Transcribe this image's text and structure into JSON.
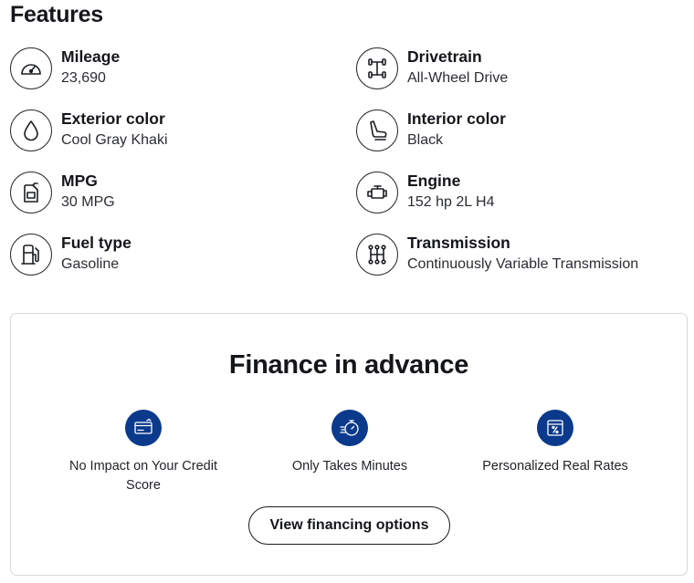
{
  "features": {
    "title": "Features",
    "items": [
      {
        "icon": "speedometer-icon",
        "label": "Mileage",
        "value": "23,690"
      },
      {
        "icon": "drivetrain-icon",
        "label": "Drivetrain",
        "value": "All-Wheel Drive"
      },
      {
        "icon": "drop-icon",
        "label": "Exterior color",
        "value": "Cool Gray Khaki"
      },
      {
        "icon": "car-seat-icon",
        "label": "Interior color",
        "value": "Black"
      },
      {
        "icon": "fuel-can-icon",
        "label": "MPG",
        "value": "30 MPG"
      },
      {
        "icon": "engine-icon",
        "label": "Engine",
        "value": "152 hp 2L H4"
      },
      {
        "icon": "gas-pump-icon",
        "label": "Fuel type",
        "value": "Gasoline"
      },
      {
        "icon": "gear-shift-icon",
        "label": "Transmission",
        "value": "Continuously Variable Transmission"
      }
    ]
  },
  "finance": {
    "title": "Finance in advance",
    "benefits": [
      {
        "icon": "credit-card-icon",
        "text": "No Impact on Your Credit Score"
      },
      {
        "icon": "stopwatch-icon",
        "text": "Only Takes Minutes"
      },
      {
        "icon": "percent-rate-icon",
        "text": "Personalized Real Rates"
      }
    ],
    "button_label": "View financing options"
  },
  "colors": {
    "text": "#14161a",
    "accent": "#0b3a8c",
    "border": "#d6d8dc"
  }
}
